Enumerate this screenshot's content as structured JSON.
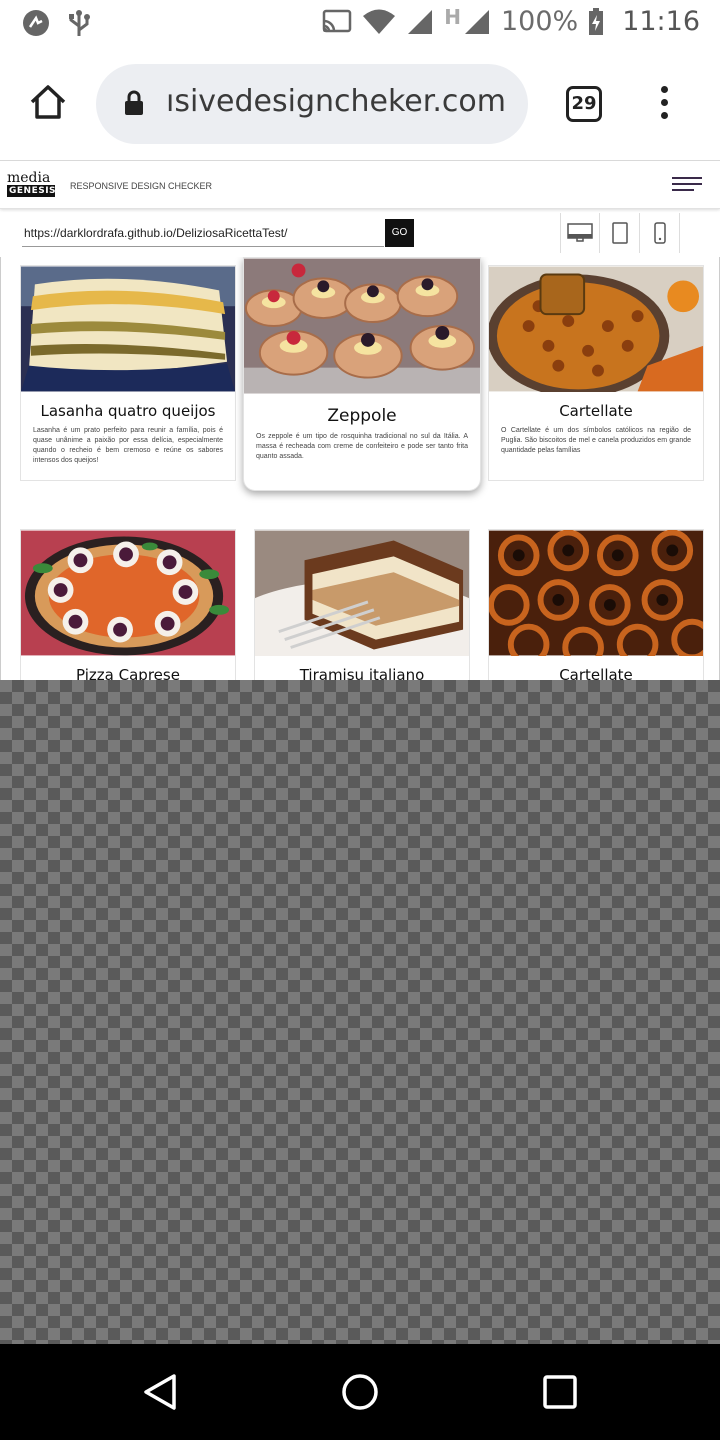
{
  "status_bar": {
    "battery": "100%",
    "time": "11:16",
    "network_label": "H"
  },
  "browser": {
    "url_display": "ısivedesigncheker.com",
    "tab_count": "29"
  },
  "site": {
    "logo_top": "media",
    "logo_bottom": "GENESIS",
    "title": "RESPONSIVE DESIGN CHECKER",
    "test_url": "https://darklordrafa.github.io/DeliziosaRicettaTest/",
    "go_label": "GO"
  },
  "cards": [
    {
      "title": "Lasanha quatro queijos",
      "text": "Lasanha é um prato perfeito para reunir a família, pois é quase unânime a paixão por essa delícia, especialmente quando o recheio é bem cremoso e reúne os sabores intensos dos queijos!"
    },
    {
      "title": "Zeppole",
      "text": "Os zeppole é um tipo de rosquinha tradicional no sul da Itália. A massa é recheada com creme de confeiteiro e pode ser tanto frita quanto assada."
    },
    {
      "title": "Cartellate",
      "text": "O Cartellate é um dos símbolos católicos na região de Puglia. São biscoitos de mel e canela produzidos em grande quantidade pelas famílias"
    },
    {
      "title": "Pizza Caprese"
    },
    {
      "title": "Tiramisu italiano"
    },
    {
      "title": "Cartellate"
    }
  ]
}
